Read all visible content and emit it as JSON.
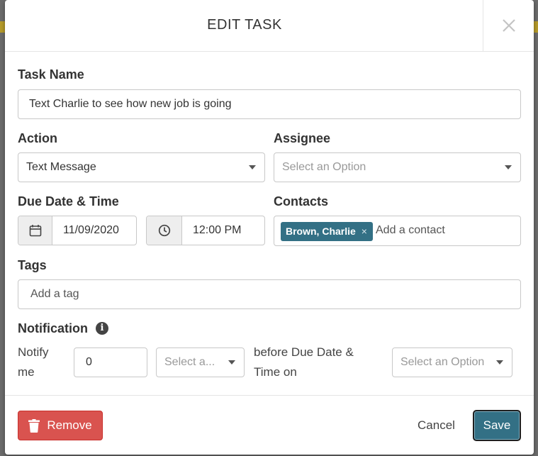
{
  "modal": {
    "title": "EDIT TASK"
  },
  "task_name": {
    "label": "Task Name",
    "value": "Text Charlie to see how new job is going"
  },
  "action": {
    "label": "Action",
    "value": "Text Message"
  },
  "assignee": {
    "label": "Assignee",
    "placeholder": "Select an Option"
  },
  "due": {
    "label": "Due Date & Time",
    "date": "11/09/2020",
    "time": "12:00 PM"
  },
  "contacts": {
    "label": "Contacts",
    "chips": [
      "Brown, Charlie"
    ],
    "chip_remove": "×",
    "placeholder": "Add a contact"
  },
  "tags": {
    "label": "Tags",
    "placeholder": "Add a tag"
  },
  "notification": {
    "label": "Notification",
    "info": "i",
    "notify_line1": "Notify",
    "notify_line2": "me",
    "amount": "0",
    "unit_placeholder": "Select a...",
    "before_line1": "before Due Date &",
    "before_line2": "Time on",
    "target_placeholder": "Select an Option"
  },
  "footer": {
    "remove_label": "Remove",
    "cancel_label": "Cancel",
    "save_label": "Save"
  },
  "icons": {
    "close": "close-icon",
    "calendar": "calendar-icon",
    "clock": "clock-icon",
    "trash": "trash-icon",
    "info": "info-icon",
    "dropdown": "chevron-down-icon"
  },
  "colors": {
    "primary": "#337085",
    "danger": "#d9534f",
    "border": "#c8c8c8",
    "addon_bg": "#eeeeee"
  }
}
